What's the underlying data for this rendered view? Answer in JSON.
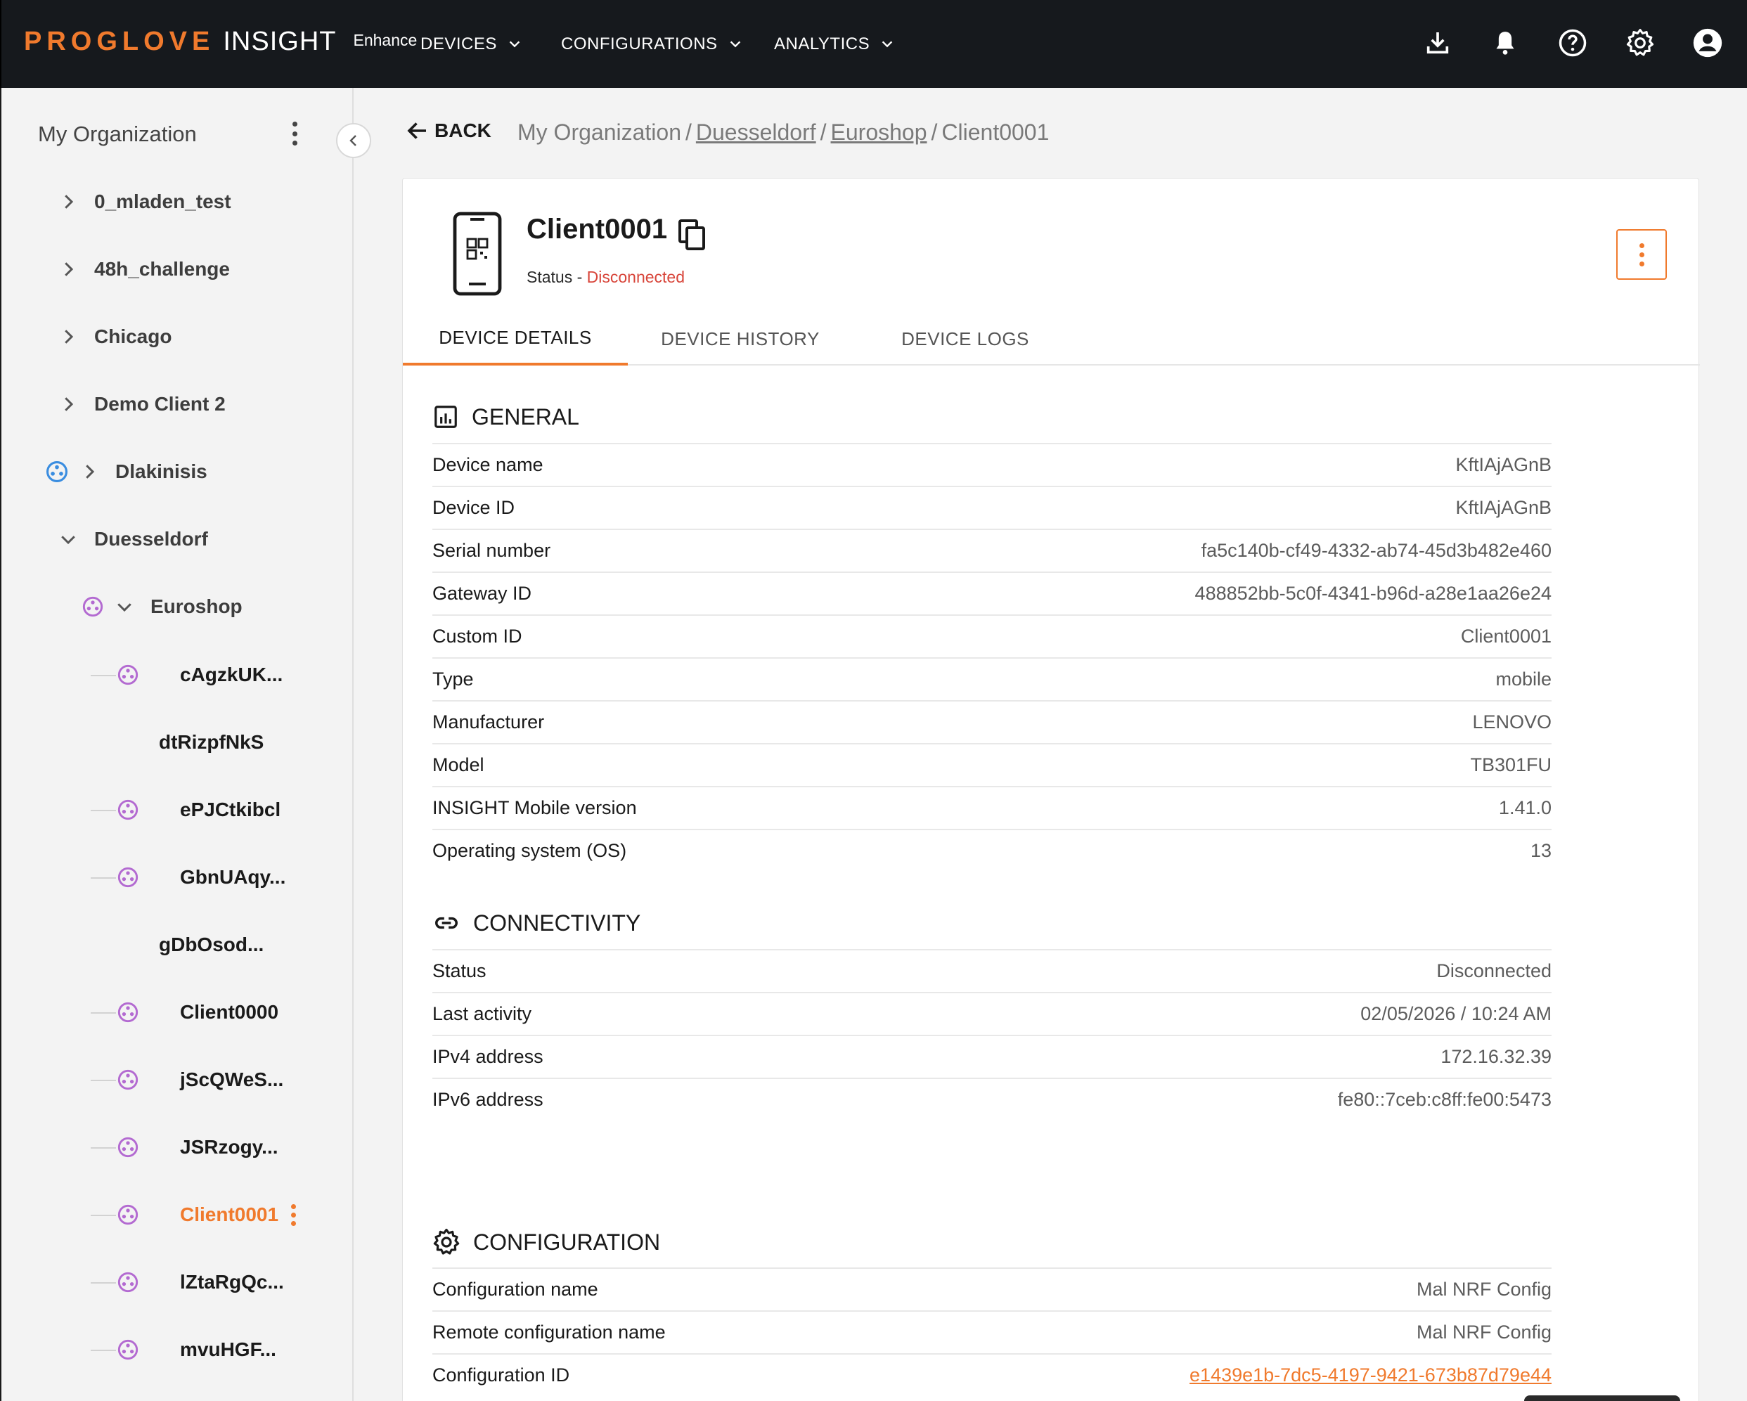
{
  "header": {
    "brand_main": "PROGLOVE",
    "brand_product": "INSIGHT",
    "brand_tier": "Enhance",
    "nav": [
      {
        "label": "DEVICES"
      },
      {
        "label": "CONFIGURATIONS"
      },
      {
        "label": "ANALYTICS"
      }
    ],
    "icons": [
      "download-icon",
      "bell-icon",
      "help-icon",
      "settings-icon",
      "account-icon"
    ]
  },
  "sidebar": {
    "title": "My Organization",
    "tree": [
      {
        "label": "0_mladen_test"
      },
      {
        "label": "48h_challenge"
      },
      {
        "label": "Chicago"
      },
      {
        "label": "Demo Client 2"
      },
      {
        "label": "Dlakinisis"
      },
      {
        "label": "Duesseldorf"
      },
      {
        "label": "Euroshop"
      },
      {
        "label": "cAgzkUK..."
      },
      {
        "label": "dtRizpfNkS"
      },
      {
        "label": "ePJCtkibcl"
      },
      {
        "label": "GbnUAqy..."
      },
      {
        "label": "gDbOsod..."
      },
      {
        "label": "Client0000"
      },
      {
        "label": "jScQWeS..."
      },
      {
        "label": "JSRzogy..."
      },
      {
        "label": "Client0001"
      },
      {
        "label": "lZtaRgQc..."
      },
      {
        "label": "mvuHGF..."
      }
    ]
  },
  "main": {
    "back_label": "BACK",
    "breadcrumb": {
      "root": "My Organization",
      "level1": "Duesseldorf",
      "level2": "Euroshop",
      "current": "Client0001",
      "separator": "/"
    },
    "device": {
      "name": "Client0001",
      "status_prefix": "Status - ",
      "status": "Disconnected"
    },
    "tabs": [
      {
        "label": "DEVICE DETAILS",
        "active": true
      },
      {
        "label": "DEVICE HISTORY",
        "active": false
      },
      {
        "label": "DEVICE LOGS",
        "active": false
      }
    ],
    "general": {
      "title": "GENERAL",
      "rows": [
        {
          "key": "Device name",
          "value": "KftIAjAGnB"
        },
        {
          "key": "Device ID",
          "value": "KftIAjAGnB"
        },
        {
          "key": "Serial number",
          "value": "fa5c140b-cf49-4332-ab74-45d3b482e460"
        },
        {
          "key": "Gateway ID",
          "value": "488852bb-5c0f-4341-b96d-a28e1aa26e24"
        },
        {
          "key": "Custom ID",
          "value": "Client0001"
        },
        {
          "key": "Type",
          "value": "mobile"
        },
        {
          "key": "Manufacturer",
          "value": "LENOVO"
        },
        {
          "key": "Model",
          "value": "TB301FU"
        },
        {
          "key": "INSIGHT Mobile version",
          "value": "1.41.0"
        },
        {
          "key": "Operating system (OS)",
          "value": "13"
        }
      ]
    },
    "connectivity": {
      "title": "CONNECTIVITY",
      "rows": [
        {
          "key": "Status",
          "value": "Disconnected"
        },
        {
          "key": "Last activity",
          "value": "02/05/2026 / 10:24 AM"
        },
        {
          "key": "IPv4 address",
          "value": "172.16.32.39"
        },
        {
          "key": "IPv6 address",
          "value": "fe80::7ceb:c8ff:fe00:5473"
        }
      ]
    },
    "configuration": {
      "title": "CONFIGURATION",
      "rows": [
        {
          "key": "Configuration name",
          "value": "Mal NRF Config"
        },
        {
          "key": "Remote configuration name",
          "value": "Mal NRF Config"
        },
        {
          "key": "Configuration ID",
          "value": "e1439e1b-7dc5-4197-9421-673b87d79e44"
        }
      ]
    }
  },
  "colors": {
    "accent": "#f07a2d",
    "topbar": "#16191d",
    "disconnected": "#d8453a",
    "device_node": "#b36ad1",
    "org_node": "#3a8de0"
  }
}
